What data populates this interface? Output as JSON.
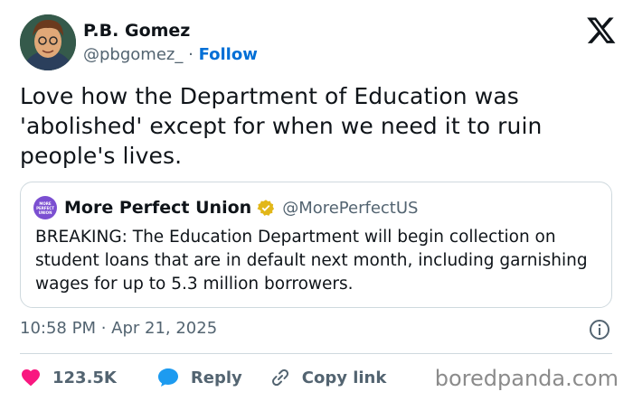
{
  "header": {
    "display_name": "P.B. Gomez",
    "handle": "@pbgomez_",
    "separator": "·",
    "follow_label": "Follow"
  },
  "tweet": {
    "text": "Love how the Department of Education was 'abolished' except for when we need it to ruin people's lives."
  },
  "quote": {
    "name": "More Perfect Union",
    "handle": "@MorePerfectUS",
    "text": "BREAKING: The Education Department will begin collection on student loans that are in default next month, including garnishing wages for up to 5.3 million borrowers.",
    "avatar_text": "MORE PERFECT UNION"
  },
  "meta": {
    "timestamp": "10:58 PM · Apr 21, 2025"
  },
  "actions": {
    "like_count": "123.5K",
    "reply_label": "Reply",
    "copy_link_label": "Copy link"
  },
  "watermark": "boredpanda.com",
  "colors": {
    "follow": "#006fd6",
    "like": "#f91880",
    "reply": "#1d9bf0",
    "verified": "#e2b719"
  }
}
